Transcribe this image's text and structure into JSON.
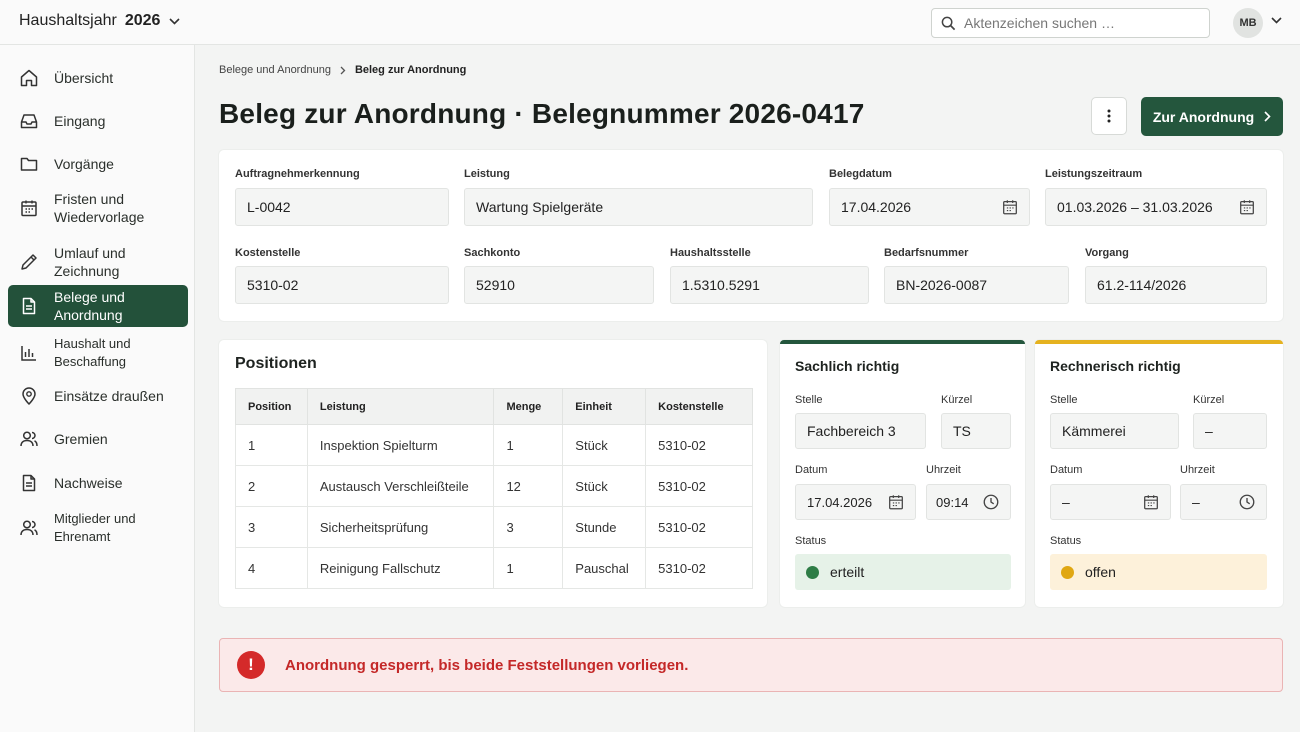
{
  "header": {
    "fiscal_label": "Haushaltsjahr",
    "fiscal_year": "2026",
    "search_placeholder": "Aktenzeichen suchen …",
    "user_initials": "MB"
  },
  "sidebar": {
    "items": [
      {
        "label": "Übersicht",
        "icon": "home-icon"
      },
      {
        "label": "Eingang",
        "icon": "inbox-icon"
      },
      {
        "label": "Vorgänge",
        "icon": "folder-icon"
      },
      {
        "label": "Fristen und Wiedervorlage",
        "icon": "calendar-icon"
      },
      {
        "label": "Umlauf und Zeichnung",
        "icon": "pencil-icon"
      },
      {
        "label": "Belege und Anordnung",
        "icon": "document-icon",
        "active": true
      },
      {
        "label": "Haushalt und Beschaffung",
        "icon": "bar-chart-icon"
      },
      {
        "label": "Einsätze draußen",
        "icon": "location-pin-icon"
      },
      {
        "label": "Gremien",
        "icon": "users-icon"
      },
      {
        "label": "Nachweise",
        "icon": "document-icon"
      },
      {
        "label": "Mitglieder und Ehrenamt",
        "icon": "users-icon"
      }
    ]
  },
  "breadcrumb": {
    "parent": "Belege und Anordnung",
    "current": "Beleg zur Anordnung"
  },
  "page": {
    "title": "Beleg zur Anordnung · Belegnummer 2026-0417",
    "primary_action": "Zur Anordnung"
  },
  "details": {
    "auftragnehmer": {
      "label": "Auftragnehmerkennung",
      "value": "L-0042"
    },
    "leistung": {
      "label": "Leistung",
      "value": "Wartung Spielgeräte"
    },
    "belegdatum": {
      "label": "Belegdatum",
      "value": "17.04.2026"
    },
    "leistungszeitraum": {
      "label": "Leistungszeitraum",
      "value": "01.03.2026 – 31.03.2026"
    },
    "kostenstelle": {
      "label": "Kostenstelle",
      "value": "5310-02"
    },
    "sachkonto": {
      "label": "Sachkonto",
      "value": "52910"
    },
    "haushaltsstelle": {
      "label": "Haushaltsstelle",
      "value": "1.5310.5291"
    },
    "bedarfsnummer": {
      "label": "Bedarfsnummer",
      "value": "BN-2026-0087"
    },
    "vorgang": {
      "label": "Vorgang",
      "value": "61.2-114/2026"
    }
  },
  "positions": {
    "title": "Positionen",
    "columns": [
      "Position",
      "Leistung",
      "Menge",
      "Einheit",
      "Kostenstelle"
    ],
    "rows": [
      [
        "1",
        "Inspektion Spielturm",
        "1",
        "Stück",
        "5310-02"
      ],
      [
        "2",
        "Austausch Verschleißteile",
        "12",
        "Stück",
        "5310-02"
      ],
      [
        "3",
        "Sicherheitsprüfung",
        "3",
        "Stunde",
        "5310-02"
      ],
      [
        "4",
        "Reinigung Fallschutz",
        "1",
        "Pauschal",
        "5310-02"
      ]
    ]
  },
  "sachlich": {
    "title": "Sachlich richtig",
    "accent": "#24563d",
    "stelle_label": "Stelle",
    "stelle": "Fachbereich 3",
    "kuerzel_label": "Kürzel",
    "kuerzel": "TS",
    "datum_label": "Datum",
    "datum": "17.04.2026",
    "uhrzeit_label": "Uhrzeit",
    "uhrzeit": "09:14",
    "status_label": "Status",
    "status": "erteilt",
    "status_color": "#2e7d46"
  },
  "rechnerisch": {
    "title": "Rechnerisch richtig",
    "accent": "#e5b21f",
    "stelle_label": "Stelle",
    "stelle": "Kämmerei",
    "kuerzel_label": "Kürzel",
    "kuerzel": "–",
    "datum_label": "Datum",
    "datum": "–",
    "uhrzeit_label": "Uhrzeit",
    "uhrzeit": "–",
    "status_label": "Status",
    "status": "offen",
    "status_color": "#e0a712"
  },
  "alert": {
    "icon": "!",
    "message": "Anordnung gesperrt, bis beide Feststellungen vorliegen."
  }
}
